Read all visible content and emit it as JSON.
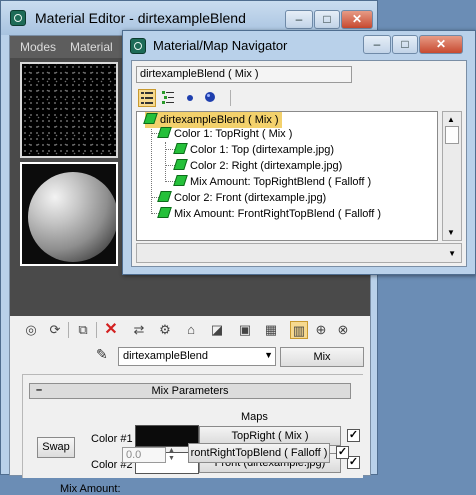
{
  "material_editor": {
    "title": "Material Editor - dirtexampleBlend",
    "menu": [
      "Modes",
      "Material"
    ],
    "window_buttons": {
      "minimize": "–",
      "maximize": "□",
      "close": "✕"
    },
    "material_name": "dirtexampleBlend",
    "material_type": "Mix",
    "mix_parameters": {
      "title": "Mix Parameters",
      "collapse": "–",
      "maps_label": "Maps",
      "swap_label": "Swap",
      "color1_label": "Color #1",
      "color2_label": "Color #2",
      "mix_amount_label": "Mix Amount:",
      "mix_amount_value": "0.0",
      "color1_swatch": "#0b0b0b",
      "color2_swatch": "#ffffff",
      "map1": "TopRight  ( Mix )",
      "map2": "Front (dirtexample.jpg)",
      "map3": "rontRightTopBlend  ( Falloff )",
      "check": "✓"
    }
  },
  "navigator": {
    "title": "Material/Map Navigator",
    "window_buttons": {
      "minimize": "–",
      "maximize": "□",
      "close": "✕"
    },
    "current": "dirtexampleBlend  ( Mix )",
    "tree": [
      "dirtexampleBlend  ( Mix )",
      "Color 1: TopRight  ( Mix )",
      "Color 1: Top (dirtexample.jpg)",
      "Color 2: Right (dirtexample.jpg)",
      "Mix Amount: TopRightBlend  ( Falloff )",
      "Color 2: Front (dirtexample.jpg)",
      "Mix Amount: FrontRightTopBlend  ( Falloff )"
    ]
  },
  "colors": {
    "highlight": "#f3d16c",
    "map_icon": "#25c03a",
    "title_bar": "#b9d1ea",
    "close_button": "#c74a30"
  }
}
